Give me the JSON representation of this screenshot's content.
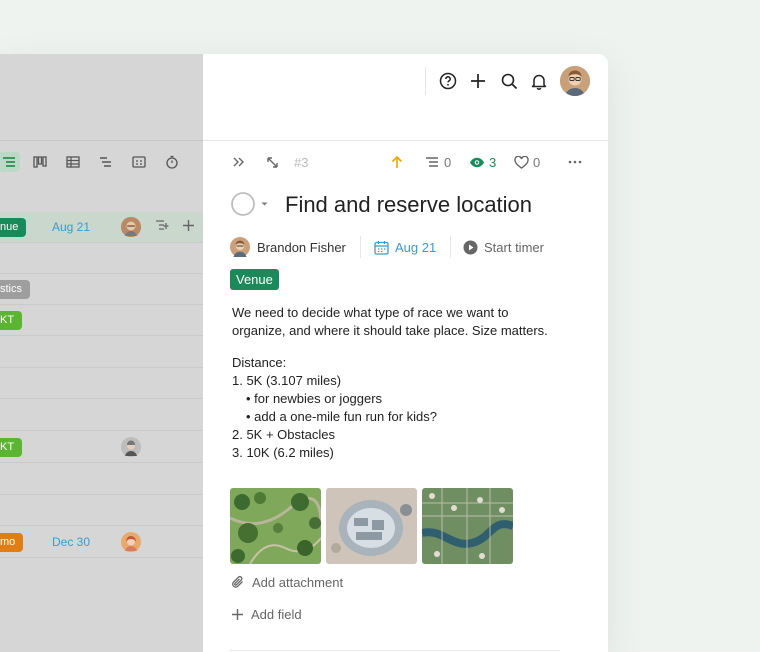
{
  "left_panel": {
    "rows": [
      {
        "tag": "nue",
        "tag_color": "#1a8a5a",
        "date": "Aug 21",
        "avatar": "man-glasses"
      },
      {
        "tag": "",
        "date": "",
        "avatar": ""
      },
      {
        "tag": "stics",
        "tag_color": "#9e9e9e",
        "date": "",
        "avatar": ""
      },
      {
        "tag": "KT",
        "tag_color": "#5cb531",
        "date": "",
        "avatar": ""
      },
      {
        "tag": "",
        "date": "",
        "avatar": ""
      },
      {
        "tag": "",
        "date": "",
        "avatar": ""
      },
      {
        "tag": "",
        "date": "",
        "avatar": ""
      },
      {
        "tag": "KT",
        "tag_color": "#5cb531",
        "date": "",
        "avatar": "man-grey"
      },
      {
        "tag": "",
        "date": "",
        "avatar": ""
      },
      {
        "tag": "",
        "date": "",
        "avatar": ""
      },
      {
        "tag": "mo",
        "tag_color": "#e07d17",
        "date": "Dec 30",
        "avatar": "woman"
      }
    ]
  },
  "task": {
    "number": "#3",
    "subtask_count": "0",
    "watchers_count": "3",
    "likes_count": "0",
    "title": "Find and reserve location",
    "assignee": "Brandon Fisher",
    "due_date": "Aug 21",
    "timer_label": "Start timer",
    "tag": "Venue",
    "description": {
      "intro": "We need to decide what type of race we want to organize, and where it should take place. Size matters.",
      "heading": "Distance:",
      "lines": [
        "1. 5K (3.107 miles)",
        "• for newbies or joggers",
        "• add a one-mile fun run for kids?",
        "2. 5K + Obstacles",
        "3. 10K (6.2 miles)"
      ]
    },
    "add_attachment": "Add attachment",
    "add_field": "Add field"
  },
  "colors": {
    "accent_green": "#1a8a5a",
    "date_blue": "#3a9ad1",
    "priority_orange": "#f0a500"
  }
}
